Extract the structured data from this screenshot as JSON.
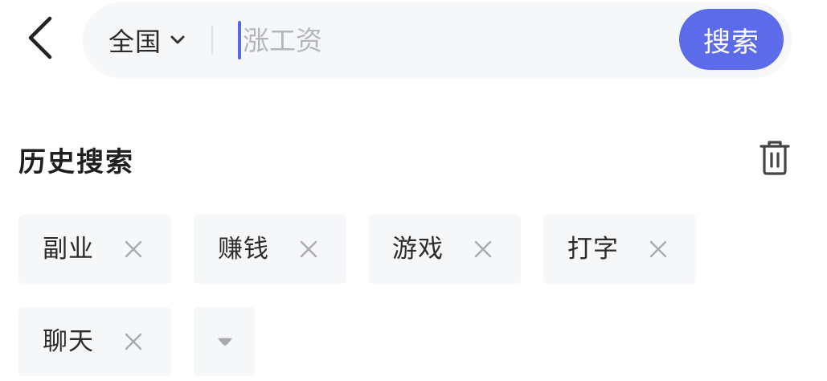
{
  "header": {
    "region_label": "全国",
    "search_placeholder": "涨工资",
    "search_value": "",
    "search_button_label": "搜索",
    "accent_color": "#5b6bea"
  },
  "history": {
    "title": "历史搜索",
    "tags": [
      {
        "label": "副业"
      },
      {
        "label": "赚钱"
      },
      {
        "label": "游戏"
      },
      {
        "label": "打字"
      },
      {
        "label": "聊天"
      }
    ],
    "icons": {
      "back": "chevron-left-icon",
      "region_toggle": "chevron-down-icon",
      "clear": "trash-icon",
      "remove": "close-icon",
      "expand": "caret-down-icon"
    }
  }
}
